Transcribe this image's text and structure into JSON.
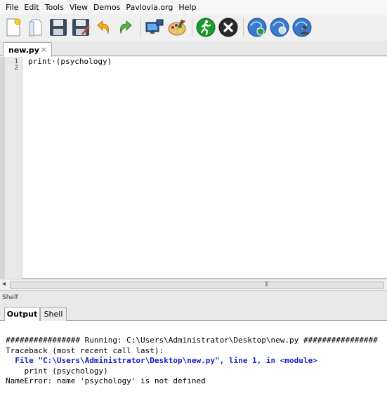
{
  "menu": [
    "File",
    "Edit",
    "Tools",
    "View",
    "Demos",
    "Pavlovia.org",
    "Help"
  ],
  "toolbar": {
    "icons": [
      "new-file-icon",
      "open-file-icon",
      "save-icon",
      "save-as-icon",
      "undo-icon",
      "redo-icon",
      "monitor-center-icon",
      "color-picker-icon",
      "run-icon",
      "stop-icon",
      "pavlovia-sync-icon",
      "pavlovia-search-icon",
      "pavlovia-user-icon"
    ]
  },
  "editor": {
    "tab_label": "new.py",
    "tab_close": "×",
    "line_numbers": [
      "1",
      "2"
    ],
    "code_lines": [
      "print·(psychology)",
      ""
    ]
  },
  "scrollbar": {
    "left_arrow": "◂",
    "grip": "|||"
  },
  "shelf": {
    "label": "Shelf"
  },
  "output_tabs": {
    "active": "Output",
    "inactive": "Shell"
  },
  "output": {
    "line1": "################ Running: C:\\Users\\Administrator\\Desktop\\new.py ################",
    "line2": "Traceback (most recent call last):",
    "line3": "  File \"C:\\Users\\Administrator\\Desktop\\new.py\", line 1, in <module>",
    "line4": "    print (psychology)",
    "line5": "NameError: name 'psychology' is not defined"
  },
  "colors": {
    "traceback_file_line": "#1020c8",
    "run_icon": "#1a9a2a",
    "stop_icon": "#2a2a2a"
  }
}
